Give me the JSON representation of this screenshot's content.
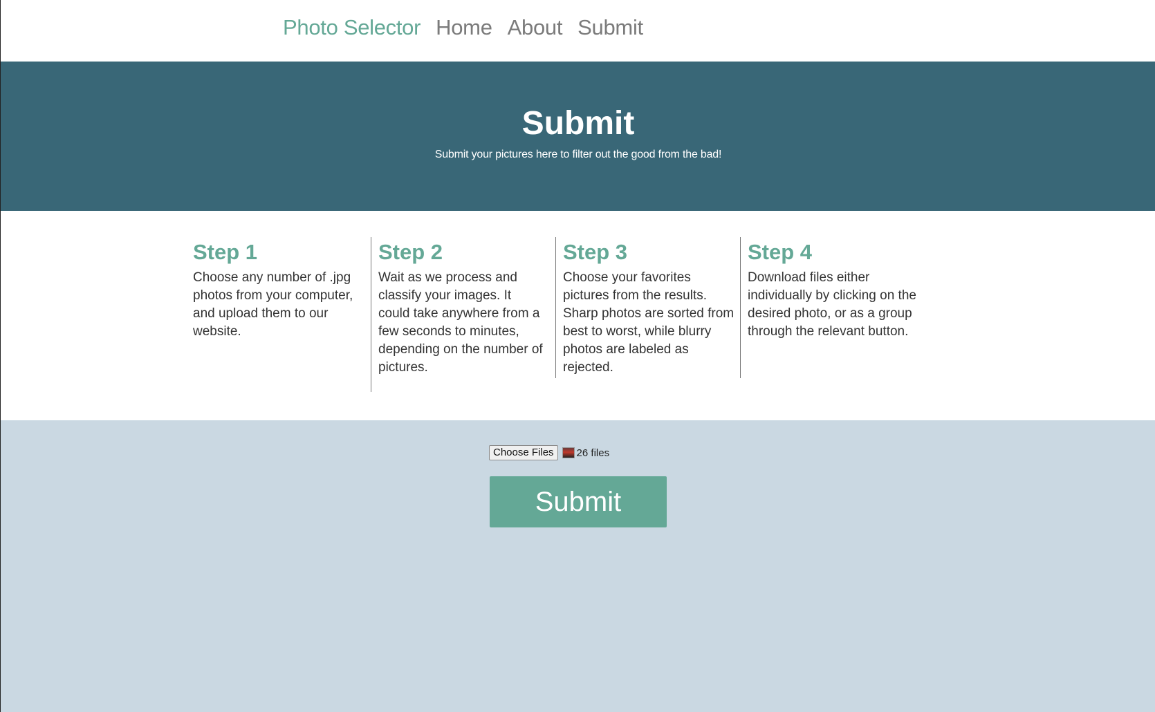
{
  "nav": {
    "brand": "Photo Selector",
    "links": [
      "Home",
      "About",
      "Submit"
    ]
  },
  "hero": {
    "title": "Submit",
    "subtitle": "Submit your pictures here to filter out the good from the bad!"
  },
  "steps": [
    {
      "title": "Step 1",
      "body": "Choose any number of .jpg photos from your computer, and upload them to our website."
    },
    {
      "title": "Step 2",
      "body": "Wait as we process and classify your images. It could take anywhere from a few seconds to minutes, depending on the number of pictures."
    },
    {
      "title": "Step 3",
      "body": "Choose your favorites pictures from the results. Sharp photos are sorted from best to worst, while blurry photos are labeled as rejected."
    },
    {
      "title": "Step 4",
      "body": "Download files either individually by clicking on the desired photo, or as a group through the relevant button."
    }
  ],
  "upload": {
    "choose_label": "Choose Files",
    "file_count": "26 files",
    "submit_label": "Submit"
  },
  "colors": {
    "accent": "#64a896",
    "hero_bg": "#396777",
    "upload_bg": "#cad8e2",
    "nav_link": "#7b7b7b"
  }
}
